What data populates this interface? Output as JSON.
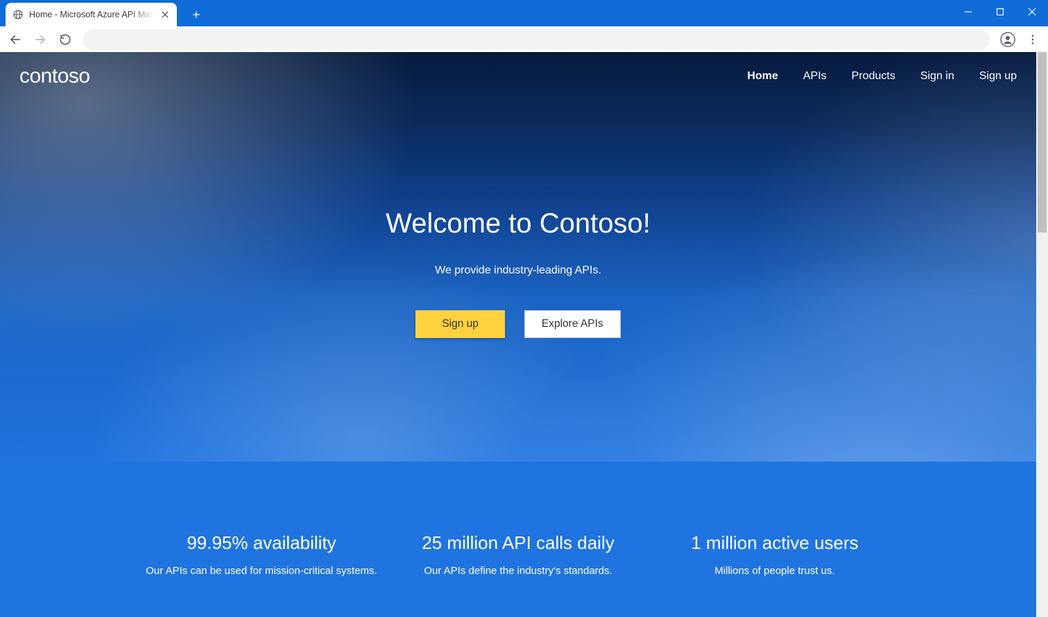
{
  "browser": {
    "tab_title": "Home - Microsoft Azure API Man",
    "address": ""
  },
  "header": {
    "brand": "contoso",
    "nav": {
      "home": "Home",
      "apis": "APIs",
      "products": "Products",
      "signin": "Sign in",
      "signup": "Sign up"
    }
  },
  "hero": {
    "title": "Welcome to Contoso!",
    "subtitle": "We provide industry-leading APIs.",
    "buttons": {
      "signup": "Sign up",
      "explore": "Explore APIs"
    }
  },
  "features": [
    {
      "title": "99.95% availability",
      "subtitle": "Our APIs can be used for mission-critical systems."
    },
    {
      "title": "25 million API calls daily",
      "subtitle": "Our APIs define the industry's standards."
    },
    {
      "title": "1 million active users",
      "subtitle": "Millions of people trust us."
    }
  ],
  "colors": {
    "chrome_accent": "#0f6cd7",
    "cta_primary": "#ffd23f",
    "hero_gradient_top": "#061a3d",
    "hero_gradient_bottom": "#1f74e0"
  }
}
